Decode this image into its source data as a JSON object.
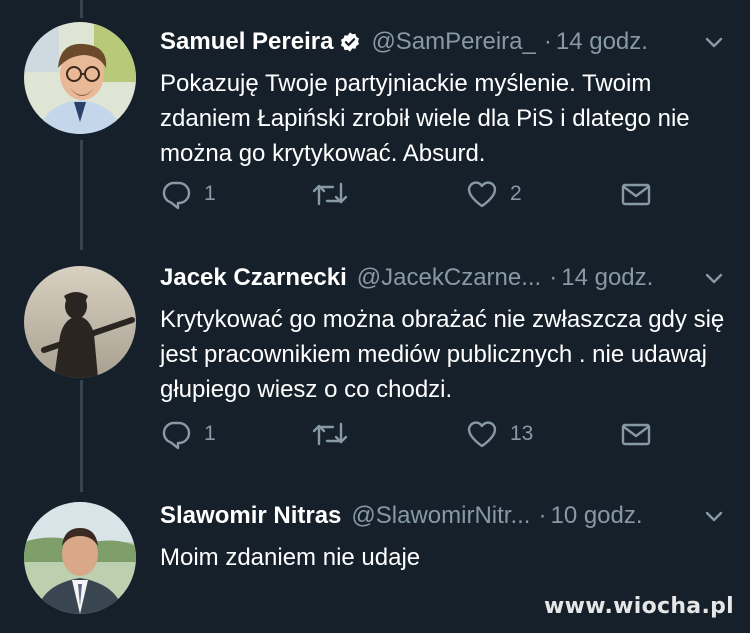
{
  "tweets": [
    {
      "name": "Samuel Pereira",
      "verified": true,
      "handle": "@SamPereira_",
      "separator": "·",
      "time": "14 godz.",
      "text": "Pokazuję Twoje partyjniackie myślenie. Twoim zdaniem Łapiński zrobił wiele dla PiS i dlatego nie można go krytykować. Absurd.",
      "replies": "1",
      "retweets": "",
      "likes": "2"
    },
    {
      "name": "Jacek Czarnecki",
      "verified": false,
      "handle": "@JacekCzarne...",
      "separator": "·",
      "time": "14 godz.",
      "text": "Krytykować go można obrażać nie zwłaszcza gdy się jest pracownikiem mediów publicznych . nie udawaj głupiego wiesz o co chodzi.",
      "replies": "1",
      "retweets": "",
      "likes": "13"
    },
    {
      "name": "Slawomir Nitras",
      "verified": false,
      "handle": "@SlawomirNitr...",
      "separator": "·",
      "time": "10 godz.",
      "text": "Moim zdaniem nie udaje"
    }
  ],
  "watermark": "www.wiocha.pl",
  "colors": {
    "background": "#15202b",
    "text": "#ffffff",
    "secondary": "#8899a6",
    "thread_line": "#38444d",
    "verified": "#ffffff"
  },
  "icons": [
    "verified-badge-icon",
    "chevron-down-icon",
    "reply-icon",
    "retweet-icon",
    "like-icon",
    "dm-icon"
  ]
}
